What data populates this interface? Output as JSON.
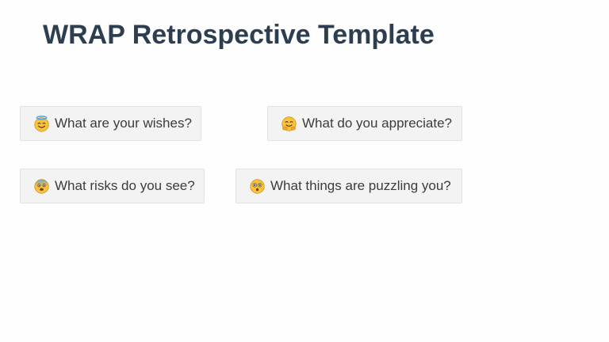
{
  "page": {
    "title": "WRAP Retrospective Template"
  },
  "cards": [
    {
      "id": "wishes",
      "label": "What are your wishes?",
      "icon": "halo-smiling-face-icon"
    },
    {
      "id": "appreciate",
      "label": "What do you appreciate?",
      "icon": "hugging-face-icon"
    },
    {
      "id": "risks",
      "label": "What risks do you see?",
      "icon": "fearful-face-icon"
    },
    {
      "id": "puzzling",
      "label": "What things are puzzling you?",
      "icon": "astonished-face-icon"
    }
  ],
  "colors": {
    "title": "#2d3e50",
    "card_background": "#f3f3f3",
    "card_border": "#e1e1e1",
    "card_text": "#3c3c3c",
    "emoji_yellow": "#f9c23c"
  }
}
